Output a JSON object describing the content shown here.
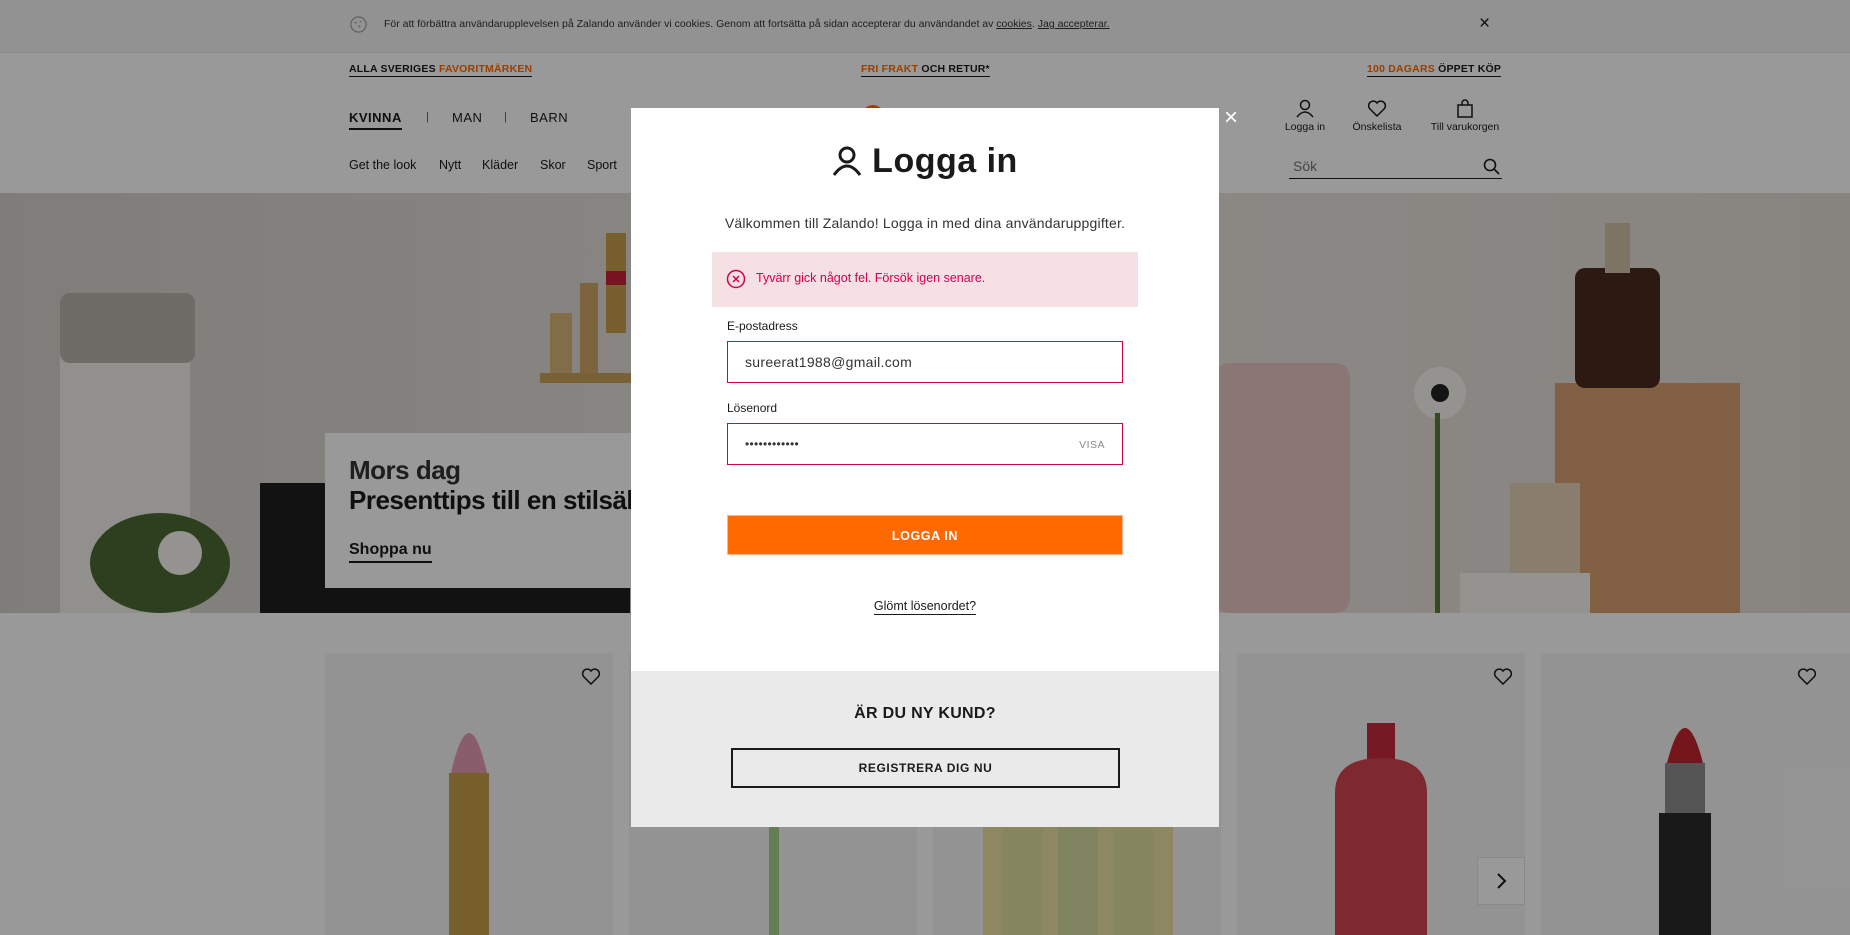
{
  "cookie_banner": {
    "text": "För att förbättra användarupplevelsen på Zalando använder vi cookies. Genom att fortsätta på sidan accepterar du användandet av ",
    "cookies_link": "cookies",
    "separator": ". ",
    "accept_link": "Jag accepterar.",
    "close_label": "×"
  },
  "promo_bar": {
    "left_prefix": "ALLA SVERIGES ",
    "left_highlight": "FAVORITMÄRKEN",
    "center_highlight": "FRI FRAKT",
    "center_suffix": " OCH RETUR*",
    "right_highlight": "100 DAGARS",
    "right_suffix": " ÖPPET KÖP"
  },
  "gender_nav": {
    "items": [
      "KVINNA",
      "MAN",
      "BARN"
    ],
    "active": "KVINNA",
    "separator": "|"
  },
  "header_icons": {
    "login": "Logga in",
    "wishlist": "Önskelista",
    "cart": "Till varukorgen"
  },
  "category_nav": {
    "items": [
      "Get the look",
      "Nytt",
      "Kläder",
      "Skor",
      "Sport"
    ]
  },
  "search": {
    "placeholder": "Sök"
  },
  "hero": {
    "subtitle": "Mors dag",
    "title": "Presenttips till en stilsäker",
    "cta": "Shoppa nu"
  },
  "modal": {
    "close_label": "×",
    "title": "Logga in",
    "welcome": "Välkommen till Zalando! Logga in med dina användaruppgifter.",
    "error": "Tyvärr gick något fel. Försök igen senare.",
    "email_label": "E-postadress",
    "email_value": "sureerat1988@gmail.com",
    "password_label": "Lösenord",
    "password_value": "••••••••••••",
    "show_password": "VISA",
    "login_button": "LOGGA IN",
    "forgot": "Glömt lösenordet?",
    "new_customer_title": "ÄR DU NY KUND?",
    "register_button": "REGISTRERA DIG NU"
  },
  "colors": {
    "accent": "#ff6900",
    "error": "#d10050",
    "error_bg": "#f5e1e3"
  }
}
